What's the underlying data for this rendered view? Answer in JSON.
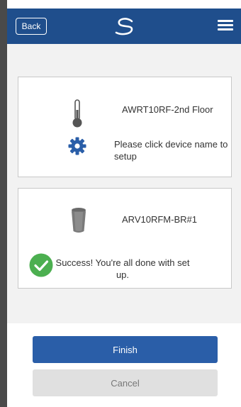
{
  "header": {
    "back_label": "Back",
    "logo_icon": "brand-swoosh-logo",
    "menu_icon": "hamburger-menu-icon",
    "bar_color": "#1f4e8c"
  },
  "devices": [
    {
      "name": "AWRT10RF-2nd Floor",
      "icon": "thermometer-icon",
      "status_icon": "gear-icon",
      "status_text": "Please click device name to setup",
      "accent_color": "#2a5ea8"
    },
    {
      "name": "ARV10RFM-BR#1",
      "icon": "radiator-valve-icon",
      "status_icon": "check-circle-icon",
      "status_text": "Success! You're all done with set up.",
      "accent_color": "#4caf50"
    }
  ],
  "footer": {
    "finish_label": "Finish",
    "cancel_label": "Cancel"
  }
}
